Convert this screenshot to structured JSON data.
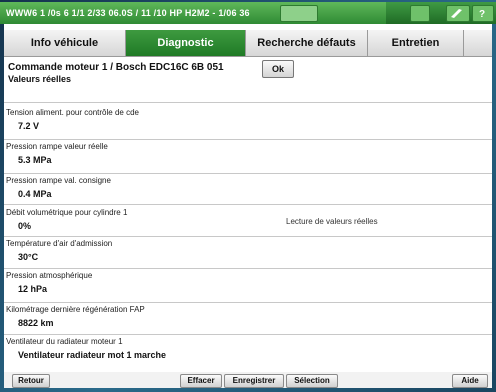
{
  "window": {
    "title": "WWW6 1 /0s 6 1/1 2/33 06.0S / 11 /10 HP H2M2 - 1/06 36"
  },
  "tabs": [
    {
      "label": "Info véhicule",
      "active": false
    },
    {
      "label": "Diagnostic",
      "active": true
    },
    {
      "label": "Recherche défauts",
      "active": false
    },
    {
      "label": "Entretien",
      "active": false
    },
    {
      "label": "",
      "active": false
    }
  ],
  "header": {
    "ecu_title": "Commande moteur 1 / Bosch EDC16C 6B 051",
    "section": "Valeurs réelles",
    "ok_button": "Ok"
  },
  "values": [
    {
      "label": "Tension aliment. pour contrôle de cde",
      "value": "7.2 V"
    },
    {
      "label": "Pression rampe valeur réelle",
      "value": "5.3 MPa"
    },
    {
      "label": "Pression rampe val. consigne",
      "value": "0.4 MPa"
    },
    {
      "label": "Débit volumétrique pour cylindre 1",
      "value": "0%"
    },
    {
      "label": "Température d'air d'admission",
      "value": "30°C"
    },
    {
      "label": "Pression atmosphérique",
      "value": "12 hPa"
    },
    {
      "label": "Kilométrage dernière régénération FAP",
      "value": "8822 km"
    },
    {
      "label": "Ventilateur du radiateur moteur 1",
      "value": "Ventilateur radiateur mot 1 marche"
    }
  ],
  "center_note": "Lecture de valeurs réelles",
  "footer": {
    "back": "Retour",
    "clear": "Effacer",
    "record": "Enregistrer",
    "selection": "Sélection",
    "help": "Aide"
  }
}
